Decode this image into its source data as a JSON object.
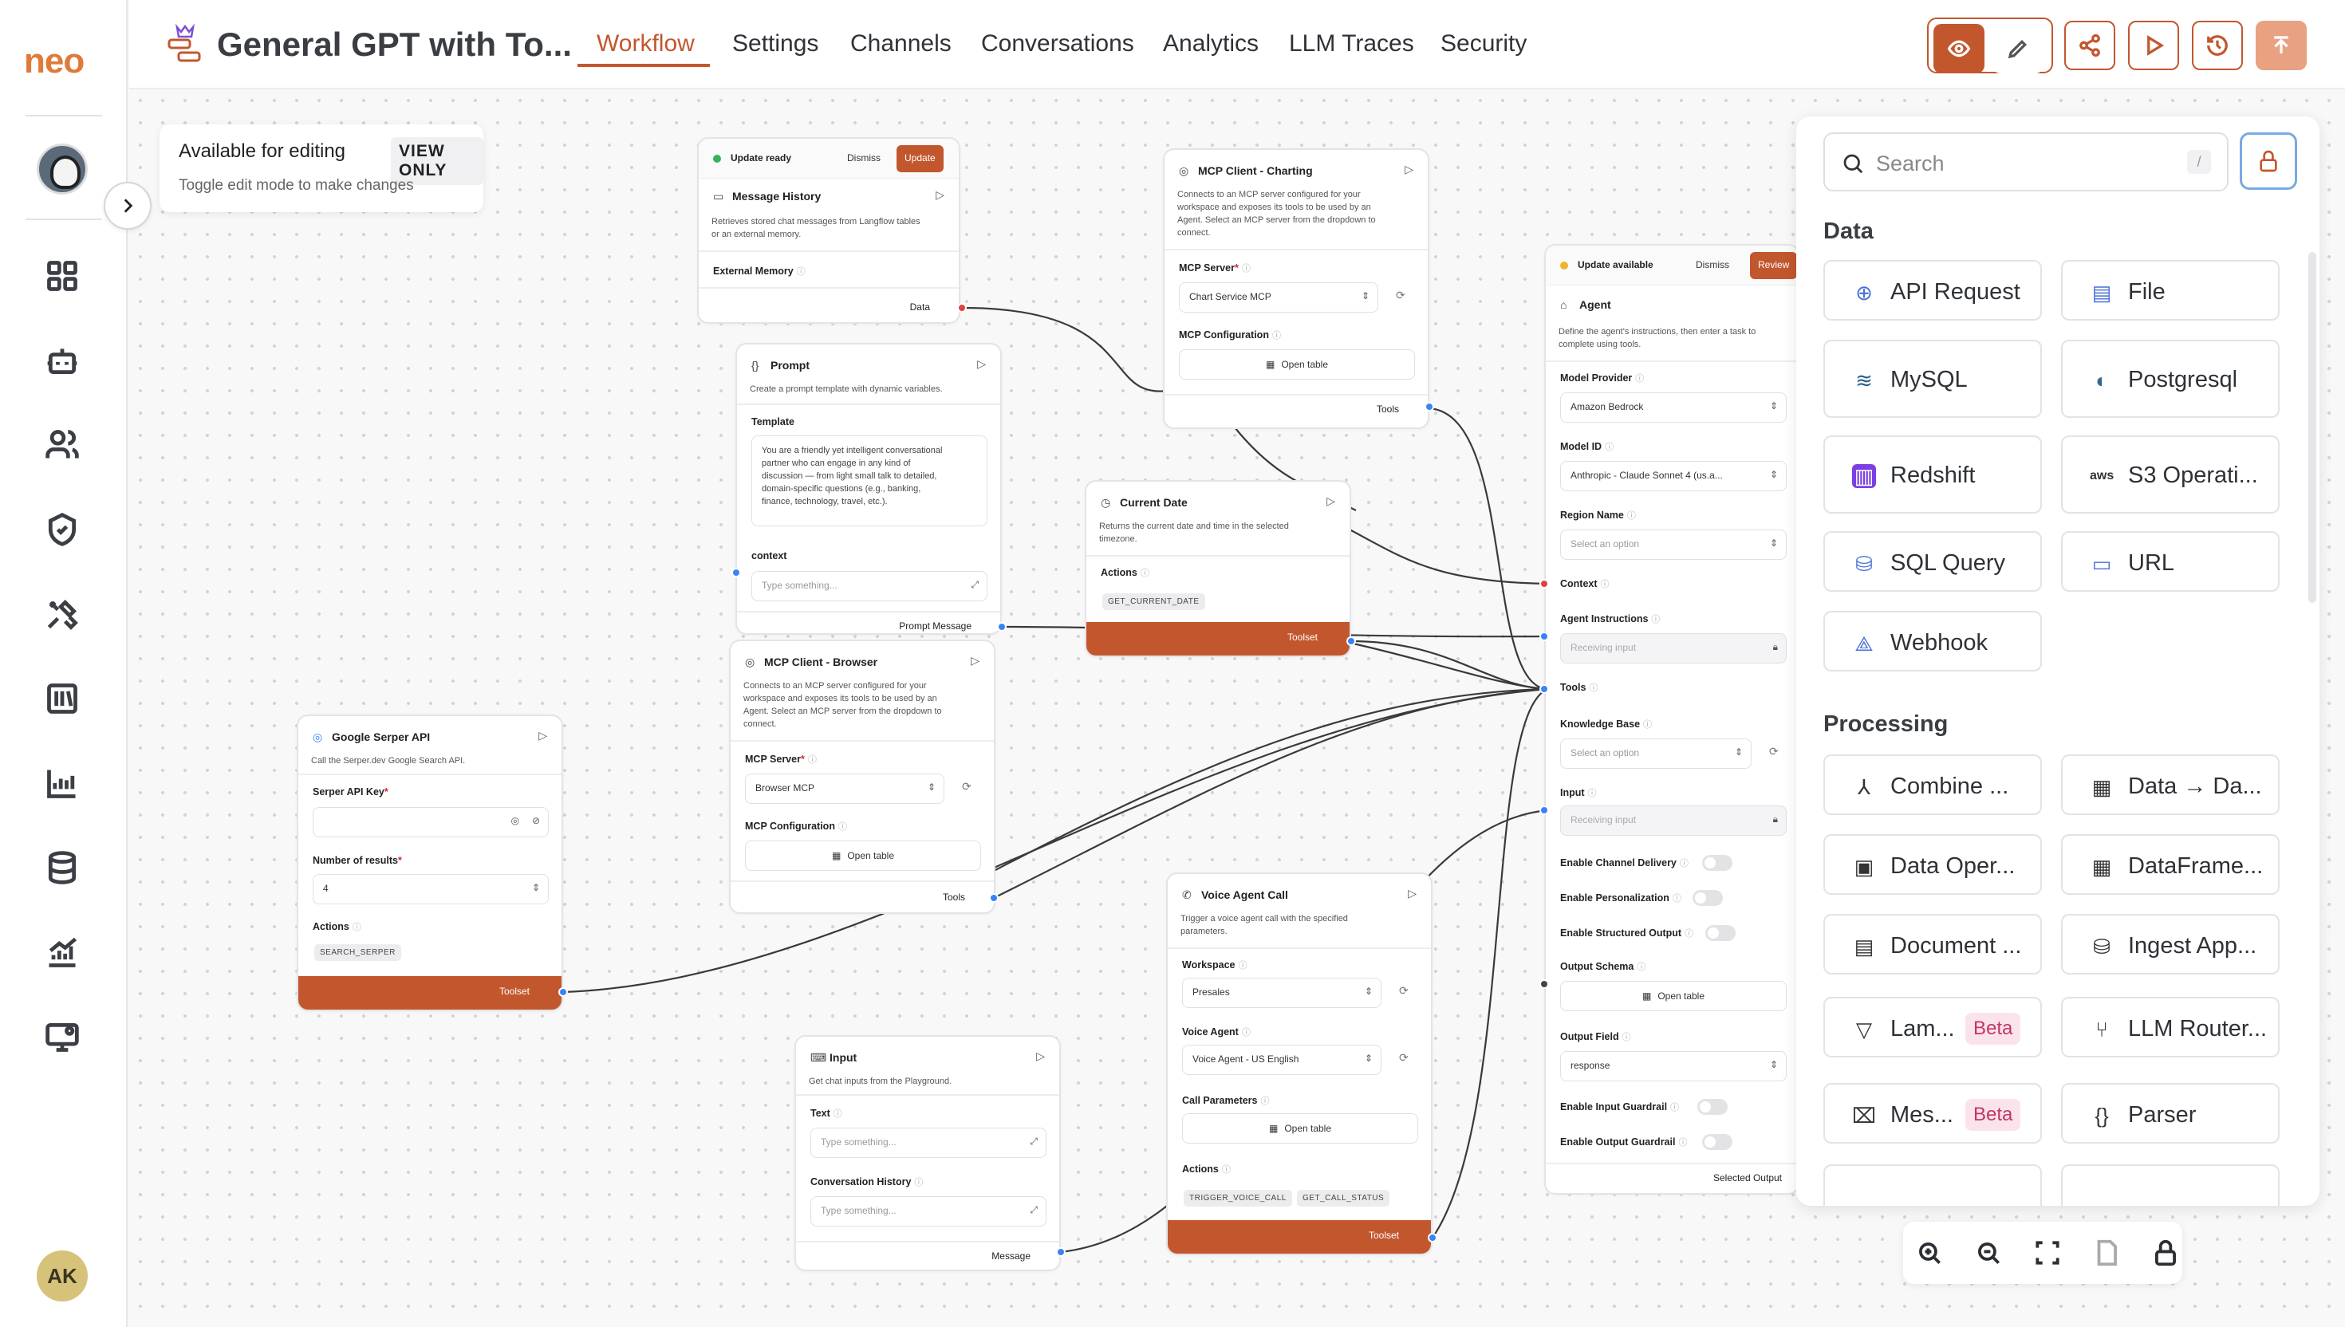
{
  "app": {
    "title": "General GPT with To...",
    "logo": "neo"
  },
  "tabs": [
    {
      "label": "Workflow",
      "active": true
    },
    {
      "label": "Settings"
    },
    {
      "label": "Channels"
    },
    {
      "label": "Conversations"
    },
    {
      "label": "Analytics"
    },
    {
      "label": "LLM Traces"
    },
    {
      "label": "Security"
    }
  ],
  "header_buttons": [
    "eye-icon",
    "pencil-icon",
    "share-icon",
    "play-icon",
    "history-icon",
    "upload-icon"
  ],
  "user": {
    "initials": "AK"
  },
  "notice": {
    "title": "Available for editing",
    "badge": "VIEW ONLY",
    "subtitle": "Toggle edit mode to make changes"
  },
  "colors": {
    "accent": "#c2572e",
    "port_red": "#e0433a",
    "port_blue": "#3b82f6",
    "port_gray": "#444"
  },
  "nodes": {
    "message_history": {
      "update_text": "Update ready",
      "dismiss": "Dismiss",
      "action": "Update",
      "title": "Message History",
      "desc1": "Retrieves stored chat messages from Langflow tables",
      "desc2": "or an external memory.",
      "field_label": "External Memory",
      "output": "Data"
    },
    "prompt": {
      "title": "Prompt",
      "desc": "Create a prompt template with dynamic variables.",
      "template_label": "Template",
      "template_text": "You are a friendly yet intelligent conversational\npartner who can engage in any kind of\ndiscussion — from light small talk to detailed,\ndomain-specific questions (e.g., banking,\nfinance, technology, travel, etc.).",
      "context_label": "context",
      "context_placeholder": "Type something...",
      "output": "Prompt Message"
    },
    "mcp_charting": {
      "title": "MCP Client - Charting",
      "desc1": "Connects to an MCP server configured for your",
      "desc2": "workspace and exposes its tools to be used by an",
      "desc3": "Agent. Select an MCP server from the dropdown to",
      "desc4": "connect.",
      "server_label": "MCP Server",
      "server_value": "Chart Service MCP",
      "config_label": "MCP Configuration",
      "config_button": "Open table",
      "output": "Tools"
    },
    "current_date": {
      "title": "Current Date",
      "desc1": "Returns the current date and time in the selected",
      "desc2": "timezone.",
      "actions_label": "Actions",
      "chip": "GET_CURRENT_DATE",
      "toolset": "Toolset"
    },
    "mcp_browser": {
      "title": "MCP Client - Browser",
      "desc1": "Connects to an MCP server configured for your",
      "desc2": "workspace and exposes its tools to be used by an",
      "desc3": "Agent. Select an MCP server from the dropdown to",
      "desc4": "connect.",
      "server_label": "MCP Server",
      "server_value": "Browser MCP",
      "config_label": "MCP Configuration",
      "config_button": "Open table",
      "output": "Tools"
    },
    "serper": {
      "title": "Google Serper API",
      "desc": "Call the Serper.dev Google Search API.",
      "key_label": "Serper API Key",
      "results_label": "Number of results",
      "results_value": "4",
      "actions_label": "Actions",
      "chip": "SEARCH_SERPER",
      "toolset": "Toolset"
    },
    "voice": {
      "title": "Voice Agent Call",
      "desc1": "Trigger a voice agent call with the specified",
      "desc2": "parameters.",
      "workspace_label": "Workspace",
      "workspace_value": "Presales",
      "agent_label": "Voice Agent",
      "agent_value": "Voice Agent - US English",
      "params_label": "Call Parameters",
      "params_button": "Open table",
      "actions_label": "Actions",
      "chip1": "TRIGGER_VOICE_CALL",
      "chip2": "GET_CALL_STATUS",
      "toolset": "Toolset"
    },
    "input": {
      "title": "Input",
      "desc": "Get chat inputs from the Playground.",
      "text_label": "Text",
      "text_placeholder": "Type something...",
      "history_label": "Conversation History",
      "history_placeholder": "Type something...",
      "output": "Message"
    },
    "agent": {
      "update_text": "Update available",
      "dismiss": "Dismiss",
      "action": "Review",
      "title": "Agent",
      "desc1": "Define the agent's instructions, then enter a task to",
      "desc2": "complete using tools.",
      "provider_label": "Model Provider",
      "provider_value": "Amazon Bedrock",
      "model_label": "Model ID",
      "model_value": "Anthropic - Claude Sonnet 4 (us.a...",
      "region_label": "Region Name",
      "region_value": "Select an option",
      "context_label": "Context",
      "instructions_label": "Agent Instructions",
      "instructions_value": "Receiving input",
      "tools_label": "Tools",
      "kb_label": "Knowledge Base",
      "kb_value": "Select an option",
      "input_label": "Input",
      "input_value": "Receiving input",
      "channel_label": "Enable Channel Delivery",
      "personal_label": "Enable Personalization",
      "structured_label": "Enable Structured Output",
      "schema_label": "Output Schema",
      "schema_button": "Open table",
      "field_label": "Output Field",
      "field_value": "response",
      "input_guard_label": "Enable Input Guardrail",
      "output_guard_label": "Enable Output Guardrail",
      "output": "Selected Output"
    }
  },
  "panel": {
    "search_placeholder": "Search",
    "search_key": "/",
    "data_title": "Data",
    "data_items": [
      {
        "label": "API Request",
        "icon": "globe-icon"
      },
      {
        "label": "File",
        "icon": "file-icon"
      },
      {
        "label": "MySQL",
        "icon": "mysql-icon"
      },
      {
        "label": "Postgresql",
        "icon": "postgres-icon"
      },
      {
        "label": "Redshift",
        "icon": "redshift-icon"
      },
      {
        "label": "S3 Operati...",
        "icon": "aws-icon"
      },
      {
        "label": "SQL Query",
        "icon": "database-icon"
      },
      {
        "label": "URL",
        "icon": "link-icon"
      },
      {
        "label": "Webhook",
        "icon": "webhook-icon"
      }
    ],
    "processing_title": "Processing",
    "processing_items": [
      {
        "label": "Combine ...",
        "icon": "merge-icon"
      },
      {
        "label": "Data → Da...",
        "icon": "table-icon"
      },
      {
        "label": "Data Oper...",
        "icon": "file-code-icon"
      },
      {
        "label": "DataFrame...",
        "icon": "table-icon"
      },
      {
        "label": "Document ...",
        "icon": "document-icon"
      },
      {
        "label": "Ingest App...",
        "icon": "database-icon"
      },
      {
        "label": "Lam...",
        "icon": "filter-icon",
        "badge": "Beta"
      },
      {
        "label": "LLM Router...",
        "icon": "router-icon"
      },
      {
        "label": "Mes...",
        "icon": "message-icon",
        "badge": "Beta"
      },
      {
        "label": "Parser",
        "icon": "braces-icon"
      }
    ]
  },
  "zoom_controls": [
    "zoom-in-icon",
    "zoom-out-icon",
    "fit-view-icon",
    "page-icon",
    "lock-icon"
  ]
}
